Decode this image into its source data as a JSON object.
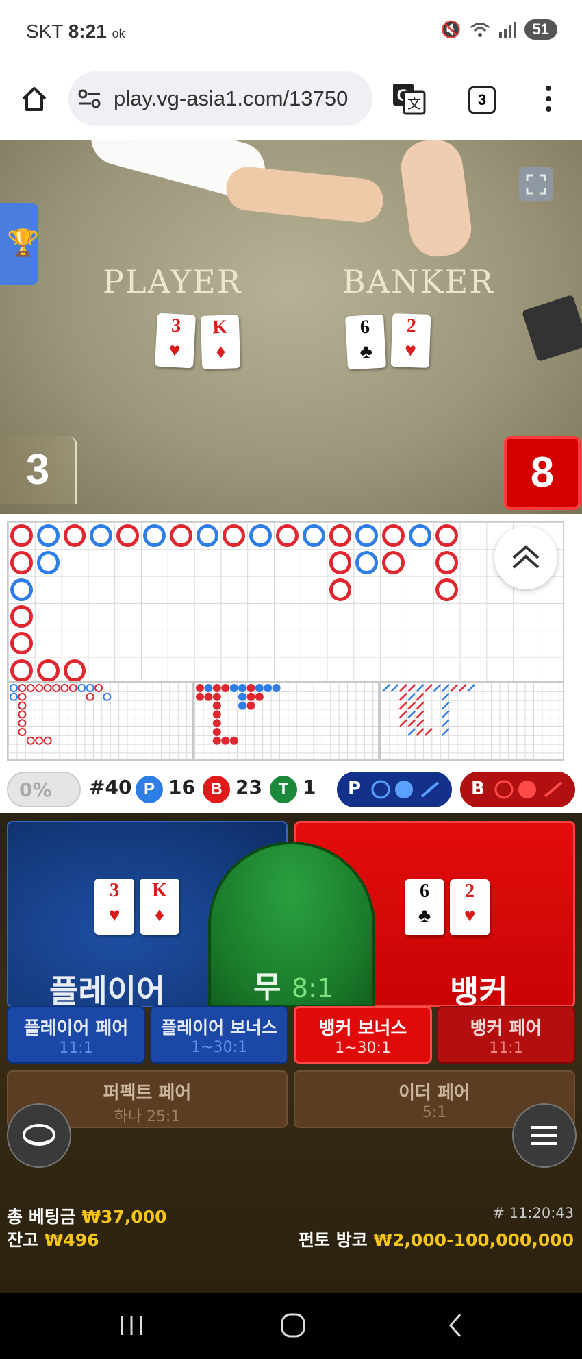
{
  "status_bar": {
    "carrier": "SKT",
    "time": "8:21",
    "ok": "ok",
    "battery": "51"
  },
  "browser": {
    "url": "play.vg-asia1.com/13750",
    "tab_count": "3"
  },
  "video": {
    "player_label": "PLAYER",
    "banker_label": "BANKER",
    "player_cards": [
      {
        "rank": "3",
        "suit": "♥",
        "color": "red"
      },
      {
        "rank": "K",
        "suit": "♦",
        "color": "red"
      }
    ],
    "banker_cards": [
      {
        "rank": "6",
        "suit": "♣",
        "color": "black"
      },
      {
        "rank": "2",
        "suit": "♥",
        "color": "red"
      }
    ],
    "player_score": "3",
    "banker_score": "8"
  },
  "roadmap": {
    "bead_road_columns": [
      [
        "B",
        "B",
        "P",
        "B",
        "B",
        "B"
      ],
      [
        "P",
        "P"
      ],
      [
        "B"
      ],
      [
        "P"
      ],
      [
        "B"
      ],
      [
        "P"
      ],
      [
        "B"
      ],
      [
        "P"
      ],
      [
        "B"
      ],
      [
        "P"
      ],
      [
        "B"
      ],
      [
        "P"
      ],
      [
        "B",
        "B",
        "B"
      ],
      [
        "P",
        "P"
      ],
      [
        "B",
        "B"
      ],
      [
        "P"
      ],
      [
        "B",
        "B",
        "B"
      ]
    ]
  },
  "stats": {
    "percent": "0%",
    "round": "#40",
    "player_letter": "P",
    "player_count": "16",
    "banker_letter": "B",
    "banker_count": "23",
    "tie_letter": "T",
    "tie_count": "1",
    "player_predict": "P",
    "banker_predict": "B"
  },
  "bets": {
    "player": {
      "name": "플레이어"
    },
    "tie": {
      "name": "무",
      "odds": "8:1"
    },
    "banker": {
      "name": "뱅커"
    },
    "player_pair": {
      "name": "플레이어 페어",
      "odds": "11:1"
    },
    "player_bonus": {
      "name": "플레이어 보너스",
      "odds": "1~30:1"
    },
    "banker_bonus": {
      "name": "뱅커 보너스",
      "odds": "1~30:1"
    },
    "banker_pair": {
      "name": "뱅커 페어",
      "odds": "11:1"
    },
    "perfect_pair": {
      "name": "퍼펙트 페어",
      "odds": "하나 25:1"
    },
    "either_pair": {
      "name": "이더 페어",
      "odds": "5:1"
    }
  },
  "footer": {
    "total_bet_label": "총 베팅금",
    "total_bet": "₩37,000",
    "balance_label": "잔고",
    "balance": "₩496",
    "round_id": "# 11:20:43",
    "limit_label": "펀토 방코",
    "limit": "₩2,000-100,000,000"
  },
  "colors": {
    "player": "#1a4fa8",
    "banker": "#d9001b",
    "tie": "#1a8a2a",
    "gold": "#f5c518"
  }
}
